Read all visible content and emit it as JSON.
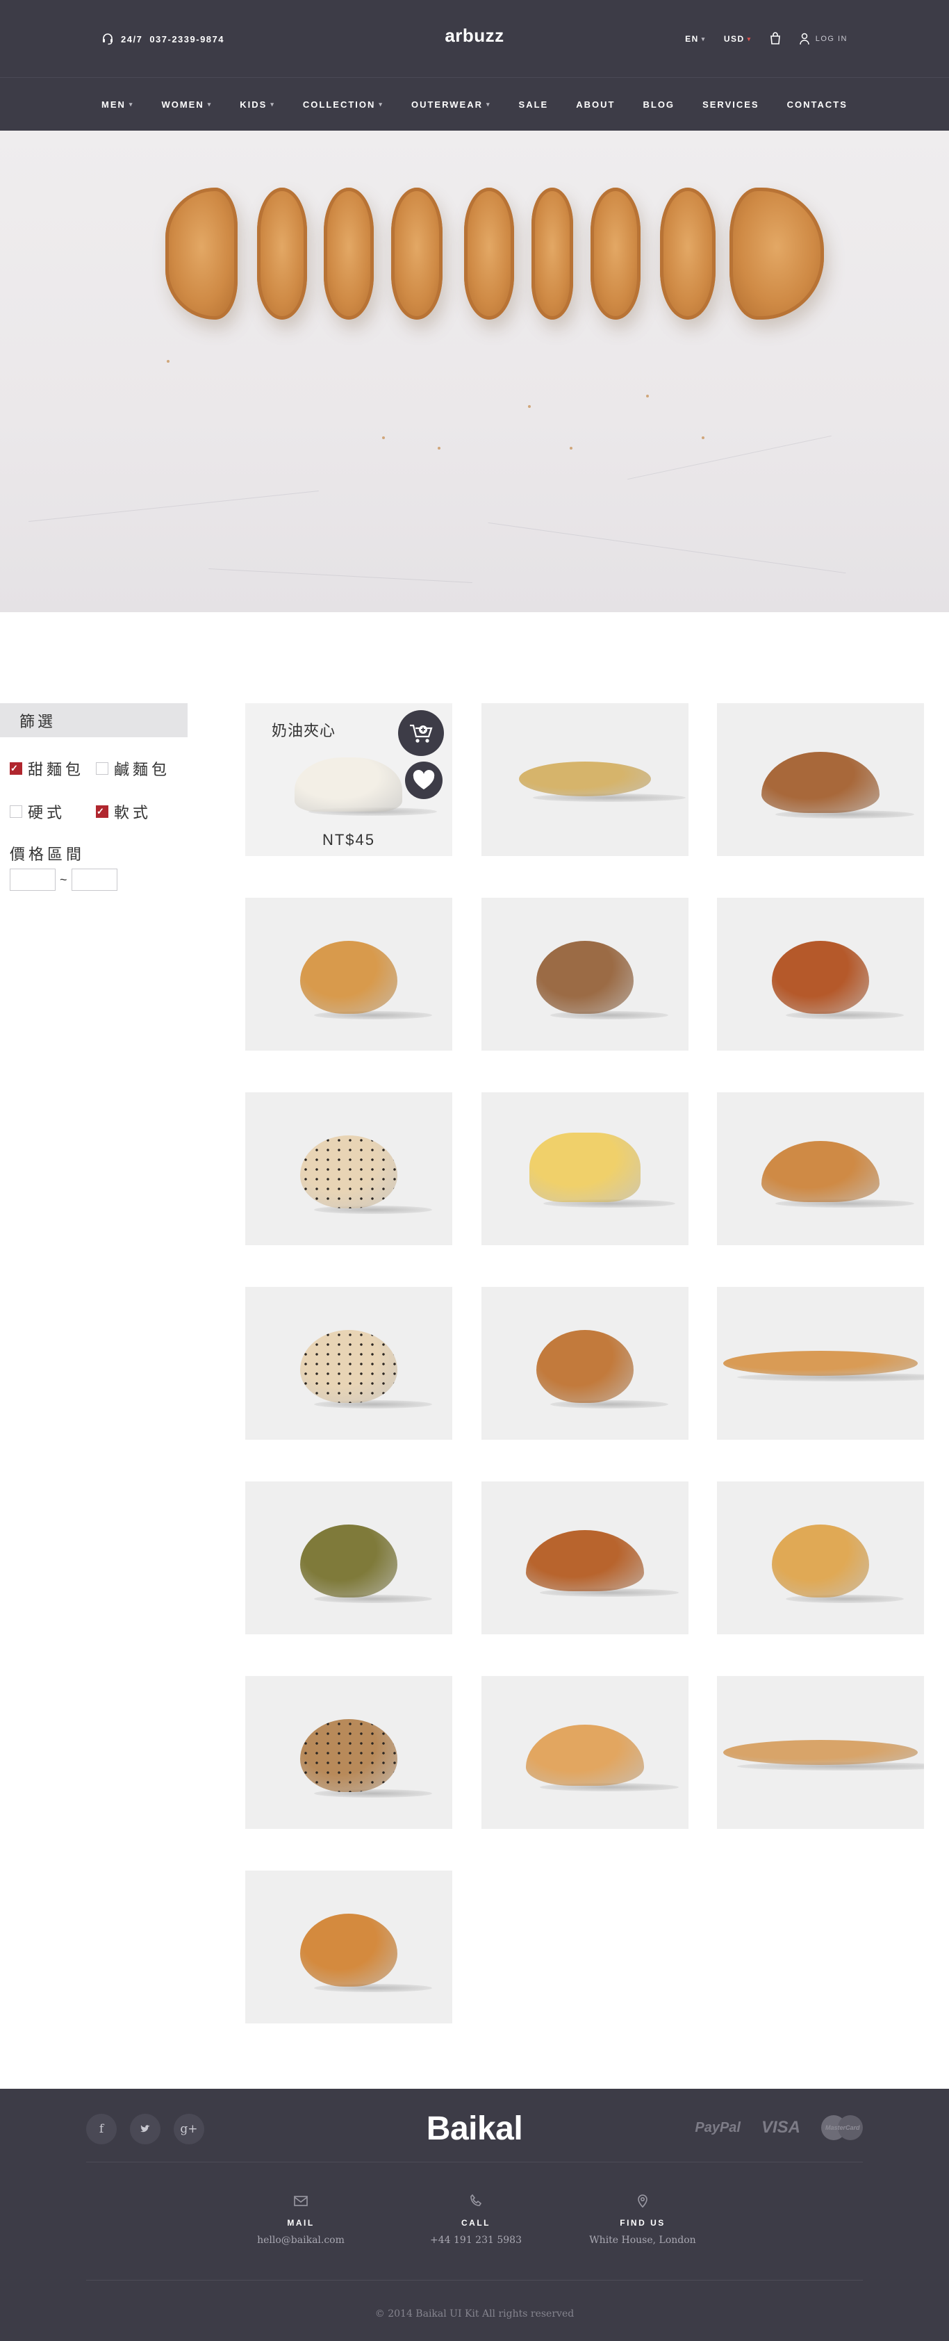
{
  "header": {
    "phone_label": "24/7",
    "phone_number": "037-2339-9874",
    "logo": "arbuzz",
    "language": "EN",
    "currency": "USD",
    "login_label": "LOG IN"
  },
  "nav": {
    "items": [
      {
        "label": "MEN",
        "dropdown": true
      },
      {
        "label": "WOMEN",
        "dropdown": true
      },
      {
        "label": "KIDS",
        "dropdown": true
      },
      {
        "label": "COLLECTION",
        "dropdown": true
      },
      {
        "label": "OUTERWEAR",
        "dropdown": true
      },
      {
        "label": "SALE",
        "dropdown": false
      },
      {
        "label": "ABOUT",
        "dropdown": false
      },
      {
        "label": "BLOG",
        "dropdown": false
      },
      {
        "label": "SERVICES",
        "dropdown": false
      },
      {
        "label": "CONTACTS",
        "dropdown": false
      }
    ]
  },
  "filter": {
    "title": "篩選",
    "options": [
      {
        "label": "甜麵包",
        "checked": true
      },
      {
        "label": "鹹麵包",
        "checked": false
      },
      {
        "label": "硬式",
        "checked": false
      },
      {
        "label": "軟式",
        "checked": true
      }
    ],
    "price_label": "價格區間",
    "price_separator": "~",
    "price_min": "",
    "price_max": ""
  },
  "products": {
    "featured": {
      "name": "奶油夾心",
      "price": "NT$45",
      "cart_icon": "cart-add-icon",
      "wishlist_icon": "heart-icon"
    },
    "items": [
      {
        "shape": "custard-bun",
        "color": "#f3efe6"
      },
      {
        "shape": "long-flat",
        "color": "#d6b46b"
      },
      {
        "shape": "batard",
        "color": "#a8683a"
      },
      {
        "shape": "round",
        "color": "#d89a4c"
      },
      {
        "shape": "round",
        "color": "#9b6b45"
      },
      {
        "shape": "round-glazed",
        "color": "#b5592a"
      },
      {
        "shape": "round-seeded",
        "color": "#e8d4b5"
      },
      {
        "shape": "croissant",
        "color": "#f0d06a"
      },
      {
        "shape": "batard",
        "color": "#cf8a45"
      },
      {
        "shape": "round-seeded",
        "color": "#e8d4b5"
      },
      {
        "shape": "round",
        "color": "#c27a3c"
      },
      {
        "shape": "baguette",
        "color": "#d99b55"
      },
      {
        "shape": "round",
        "color": "#7f7a3a"
      },
      {
        "shape": "batard",
        "color": "#b8642d"
      },
      {
        "shape": "round",
        "color": "#e0a955"
      },
      {
        "shape": "round-seeded",
        "color": "#b88a5a"
      },
      {
        "shape": "batard",
        "color": "#e2a660"
      },
      {
        "shape": "baguette",
        "color": "#d8a469"
      },
      {
        "shape": "round",
        "color": "#d48a3e"
      }
    ]
  },
  "footer": {
    "brand": "Baikal",
    "socials": [
      "f",
      "t",
      "g+"
    ],
    "payments": [
      "PayPal",
      "VISA",
      "MasterCard"
    ],
    "contacts": [
      {
        "title": "MAIL",
        "value": "hello@baikal.com",
        "icon": "mail-icon"
      },
      {
        "title": "CALL",
        "value": "+44 191 231 5983",
        "icon": "phone-icon"
      },
      {
        "title": "FIND US",
        "value": "White House, London",
        "icon": "map-pin-icon"
      }
    ],
    "copyright": "© 2014 Baikal UI Kit All rights reserved"
  }
}
